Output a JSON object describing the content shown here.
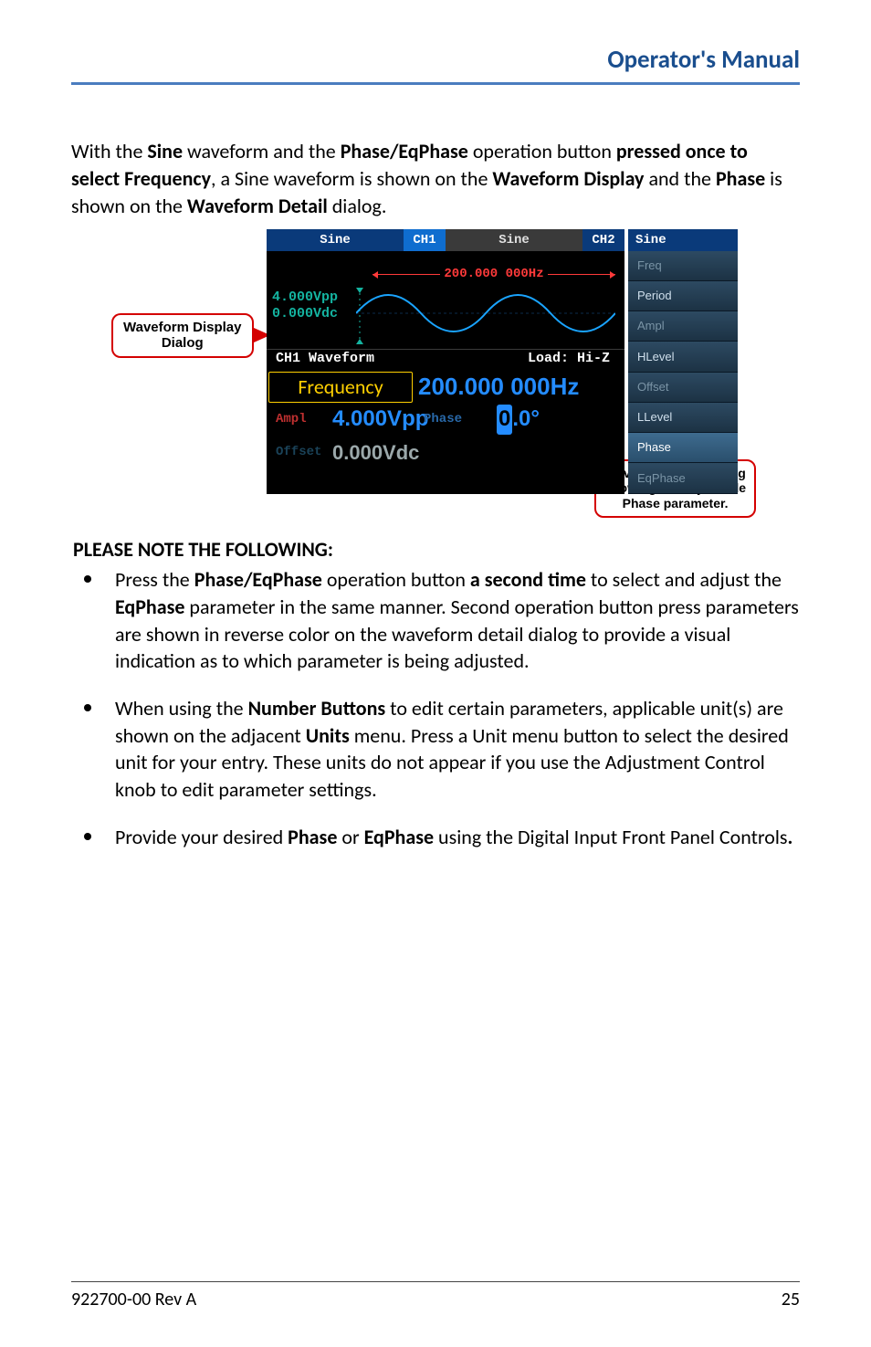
{
  "header": {
    "title": "Operator's Manual"
  },
  "intro": {
    "pre1": "With the ",
    "b1": "Sine",
    "mid1": " waveform and the ",
    "b2": "Phase/EqPhase",
    "mid2": " operation button ",
    "b3": "pressed once to select Frequency",
    "mid3": ", a Sine waveform is shown on the ",
    "b4": "Waveform Display",
    "mid4": " and the ",
    "b5": "Phase",
    "mid5": " is shown on the ",
    "b6": "Waveform Detail",
    "post": " dialog."
  },
  "callouts": {
    "left_line1": "Waveform Display",
    "left_line2": "Dialog",
    "right_line1": "Waveform Detail dialog",
    "right_line2": "showing the adjustable",
    "right_line3": "Phase parameter."
  },
  "device": {
    "tabs": {
      "l_name": "Sine",
      "l_ch": "CH1",
      "r_name": "Sine",
      "r_ch": "CH2"
    },
    "wfd": {
      "vpp": "4.000Vpp",
      "vdc": "0.000Vdc",
      "span_freq": "200.000 000Hz"
    },
    "ch1": {
      "title": "CH1 Waveform",
      "load": "Load: Hi-Z"
    },
    "detail": {
      "freq_label": "Frequency",
      "freq_value": "200.000 000Hz",
      "ampl_label": "Ampl",
      "ampl_value": "4.000Vpp",
      "phase_label": "Phase",
      "phase_cursor": "0",
      "phase_rest": ".0°",
      "off_label": "Offset",
      "off_value": "0.000Vdc"
    },
    "soft": {
      "head": "Sine",
      "items": [
        "Freq",
        "Period",
        "Ampl",
        "HLevel",
        "Offset",
        "LLevel",
        "Phase",
        "EqPhase"
      ]
    }
  },
  "notes": {
    "heading": "PLEASE NOTE THE FOLLOWING",
    "item1": {
      "t1": "Press the ",
      "b1": "Phase/EqPhase",
      "t2": " operation button ",
      "b2": "a second time",
      "t3": " to select and adjust the ",
      "b3": "EqPhase",
      "t4": " parameter in the same manner. Second operation button press parameters are shown in reverse color on the waveform detail dialog to provide a visual indication as to which parameter is being adjusted."
    },
    "item2": {
      "t1": "When using the ",
      "b1": "Number Buttons",
      "t2": " to edit certain parameters, applicable unit(s) are shown on the adjacent ",
      "b2": "Units",
      "t3": " menu. Press a Unit menu button to select the desired unit for your entry. These units do not appear if you use the Adjustment Control knob to edit parameter settings."
    },
    "item3": {
      "t1": "Provide your desired ",
      "b1": "Phase",
      "t2": " or ",
      "b2": "EqPhase",
      "t3": " using the Digital Input Front Panel Controls",
      "b3": "."
    }
  },
  "footer": {
    "doc": "922700-00 Rev A",
    "page": "25"
  }
}
